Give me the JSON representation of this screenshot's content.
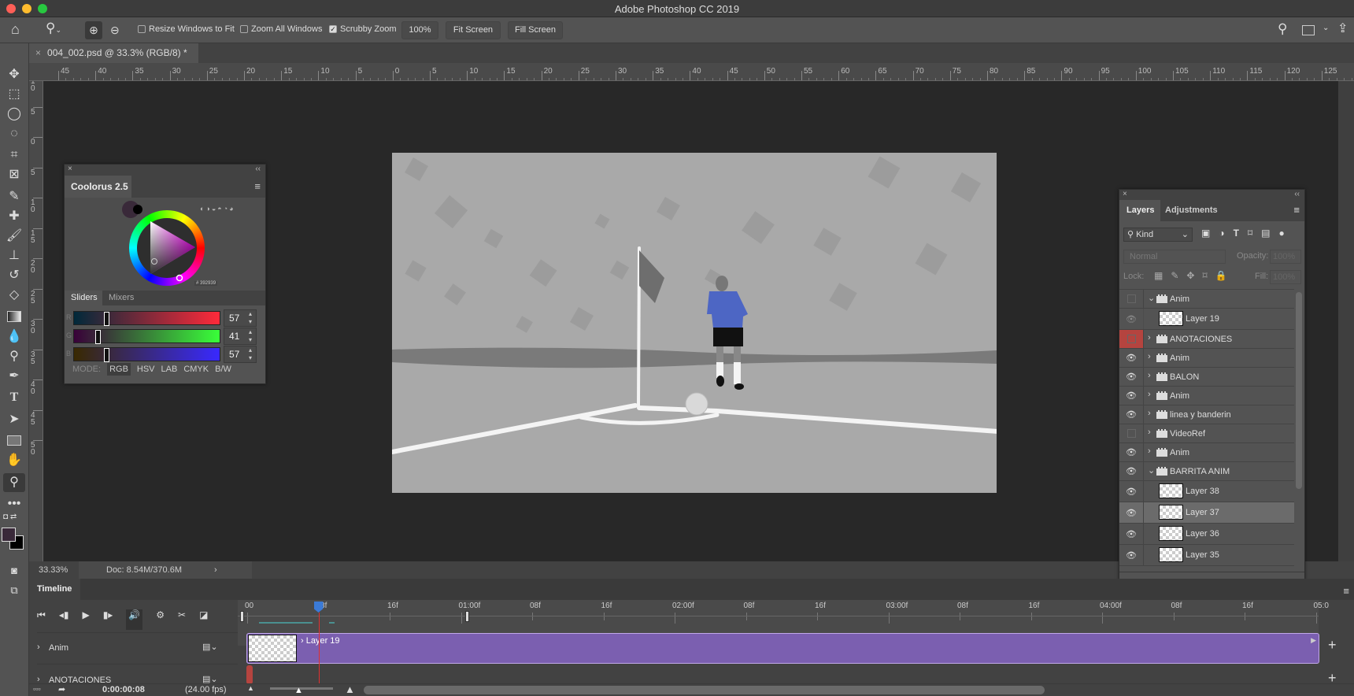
{
  "app": {
    "title": "Adobe Photoshop CC 2019"
  },
  "options": {
    "resize_windows": "Resize Windows to Fit",
    "zoom_all": "Zoom All Windows",
    "scrubby_zoom": "Scrubby Zoom",
    "zoom_100": "100%",
    "fit_screen": "Fit Screen",
    "fill_screen": "Fill Screen",
    "resize_checked": false,
    "zoom_all_checked": false,
    "scrubby_checked": true
  },
  "document": {
    "tab_label": "004_002.psd @ 33.3% (RGB/8) *",
    "close": "×"
  },
  "rulers": {
    "horizontal": [
      "45",
      "40",
      "35",
      "30",
      "25",
      "20",
      "15",
      "10",
      "5",
      "0",
      "5",
      "10",
      "15",
      "20",
      "25",
      "30",
      "35",
      "40",
      "45",
      "50",
      "55",
      "60",
      "65",
      "70",
      "75",
      "80",
      "85",
      "90",
      "95",
      "100",
      "105",
      "110",
      "115",
      "120",
      "125"
    ],
    "vertical": [
      "10",
      "5",
      "0",
      "5",
      "10",
      "15",
      "20",
      "25",
      "30",
      "35",
      "40",
      "45",
      "50"
    ]
  },
  "status": {
    "zoom": "33.33%",
    "doc": "Doc: 8.54M/370.6M"
  },
  "coolorus": {
    "title": "Coolorus 2.5",
    "hex": "# 392939",
    "tabs": [
      "Sliders",
      "Mixers"
    ],
    "sliders": [
      {
        "label": "R",
        "value": "57",
        "fraction": 0.22
      },
      {
        "label": "G",
        "value": "41",
        "fraction": 0.16
      },
      {
        "label": "B",
        "value": "57",
        "fraction": 0.22
      }
    ],
    "mode_label": "MODE:",
    "modes": [
      "RGB",
      "HSV",
      "LAB",
      "CMYK",
      "B/W"
    ],
    "active_mode": "RGB",
    "color": "#392939"
  },
  "layers_panel": {
    "tabs": [
      "Layers",
      "Adjustments"
    ],
    "filter_kind": "Kind",
    "blend_mode": "Normal",
    "opacity_label": "Opacity:",
    "opacity": "100%",
    "lock_label": "Lock:",
    "fill_label": "Fill:",
    "fill": "100%",
    "layers": [
      {
        "name": "Anim",
        "type": "group",
        "expanded": true,
        "visible": false
      },
      {
        "name": "Layer 19",
        "type": "layer",
        "visible": "dim"
      },
      {
        "name": "ANOTACIONES",
        "type": "group",
        "expanded": false,
        "visible": false,
        "color": "#b5443f"
      },
      {
        "name": "Anim",
        "type": "group",
        "expanded": false,
        "visible": true
      },
      {
        "name": "BALON",
        "type": "group",
        "expanded": false,
        "visible": true
      },
      {
        "name": "Anim",
        "type": "group",
        "expanded": false,
        "visible": true
      },
      {
        "name": "linea y banderin",
        "type": "group",
        "expanded": false,
        "visible": true
      },
      {
        "name": "VideoRef",
        "type": "group",
        "expanded": false,
        "visible": false
      },
      {
        "name": "Anim",
        "type": "group",
        "expanded": false,
        "visible": true
      },
      {
        "name": "BARRITA ANIM",
        "type": "group",
        "expanded": true,
        "visible": true
      },
      {
        "name": "Layer 38",
        "type": "layer",
        "visible": true
      },
      {
        "name": "Layer 37",
        "type": "layer",
        "visible": true,
        "selected": true
      },
      {
        "name": "Layer 36",
        "type": "layer",
        "visible": true
      },
      {
        "name": "Layer 35",
        "type": "layer",
        "visible": true
      }
    ]
  },
  "timeline": {
    "title": "Timeline",
    "ruler": [
      "00",
      "08f",
      "16f",
      "01:00f",
      "08f",
      "16f",
      "02:00f",
      "08f",
      "16f",
      "03:00f",
      "08f",
      "16f",
      "04:00f",
      "08f",
      "16f",
      "05:0"
    ],
    "tracks": [
      {
        "name": "Anim",
        "clip": "Layer 19"
      },
      {
        "name": "ANOTACIONES"
      }
    ],
    "timecode": "0:00:00:08",
    "fps": "(24.00 fps)",
    "current_frame": 8,
    "clip_color": "#7b5fb0"
  }
}
